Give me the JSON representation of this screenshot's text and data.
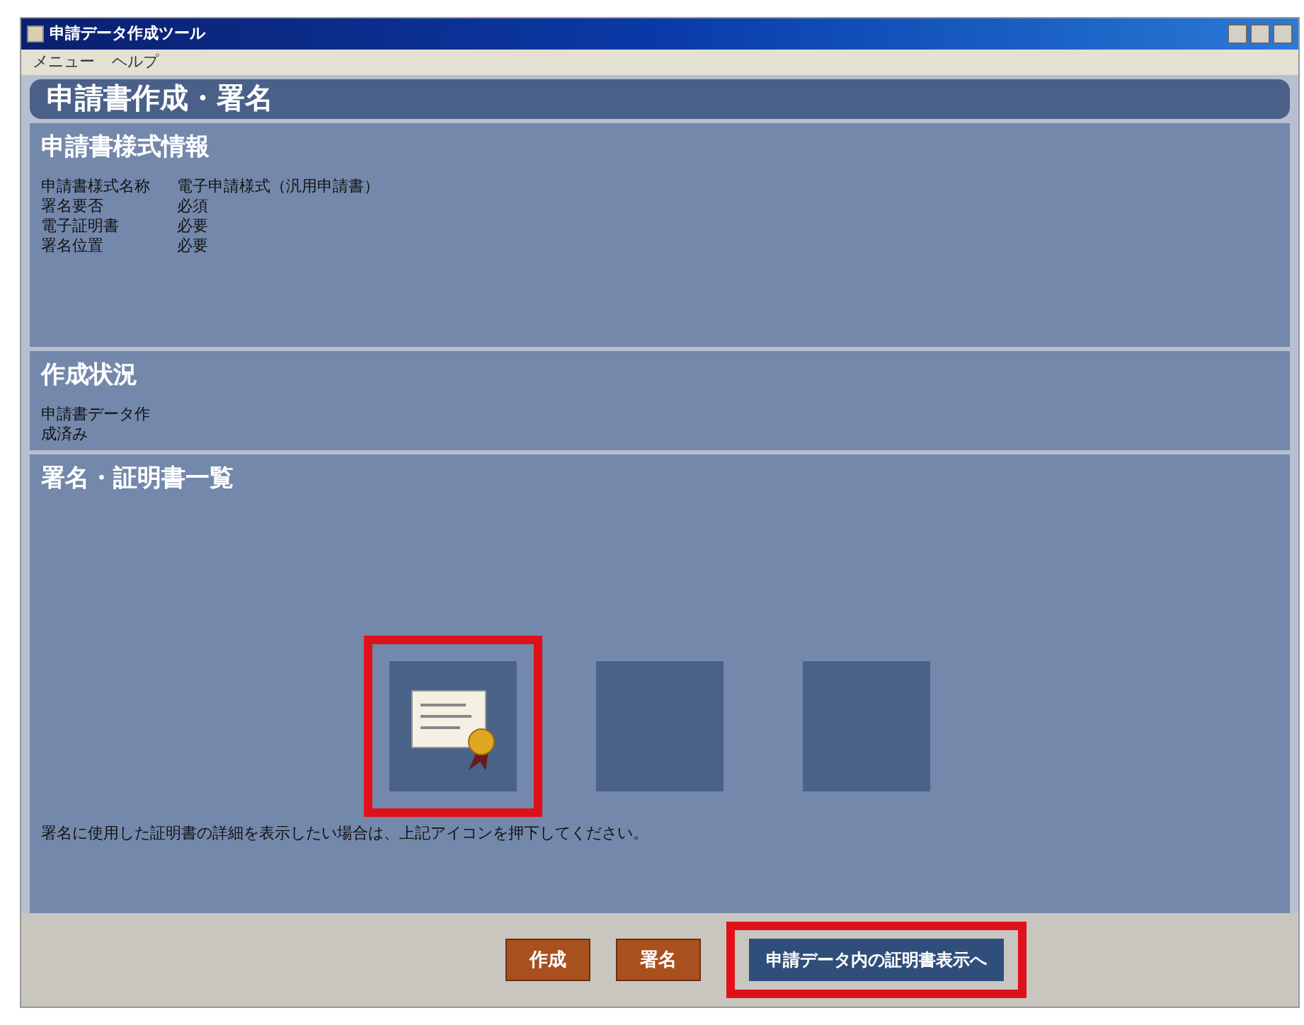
{
  "window": {
    "title": "申請データ作成ツール"
  },
  "menu": [
    "メニュー",
    "ヘルプ"
  ],
  "page_title": "申請書作成・署名",
  "sections": [
    {
      "title": "申請書様式情報",
      "rows": [
        {
          "label": "申請書様式名称",
          "value": "電子申請様式（汎用申請書）"
        },
        {
          "label": "署名要否",
          "value": "必須"
        },
        {
          "label": "電子証明書",
          "value": "必要"
        },
        {
          "label": "署名位置",
          "value": "必要"
        }
      ]
    },
    {
      "title": "作成状況",
      "rows": [
        {
          "label": "申請書データ作成済み",
          "value": ""
        }
      ]
    },
    {
      "title": "署名・証明書一覧",
      "slots": [
        {
          "kind": "certificate",
          "highlighted": true
        },
        {
          "kind": "empty",
          "highlighted": false
        },
        {
          "kind": "empty",
          "highlighted": false
        }
      ],
      "note": "署名に使用した証明書の詳細を表示したい場合は、上記アイコンを押下してください。"
    }
  ],
  "buttons": [
    {
      "label": "作成",
      "kind": "action",
      "highlighted": false
    },
    {
      "label": "署名",
      "kind": "action",
      "highlighted": false
    },
    {
      "label": "申請データ内の証明書表示へ",
      "kind": "link",
      "highlighted": true
    }
  ]
}
